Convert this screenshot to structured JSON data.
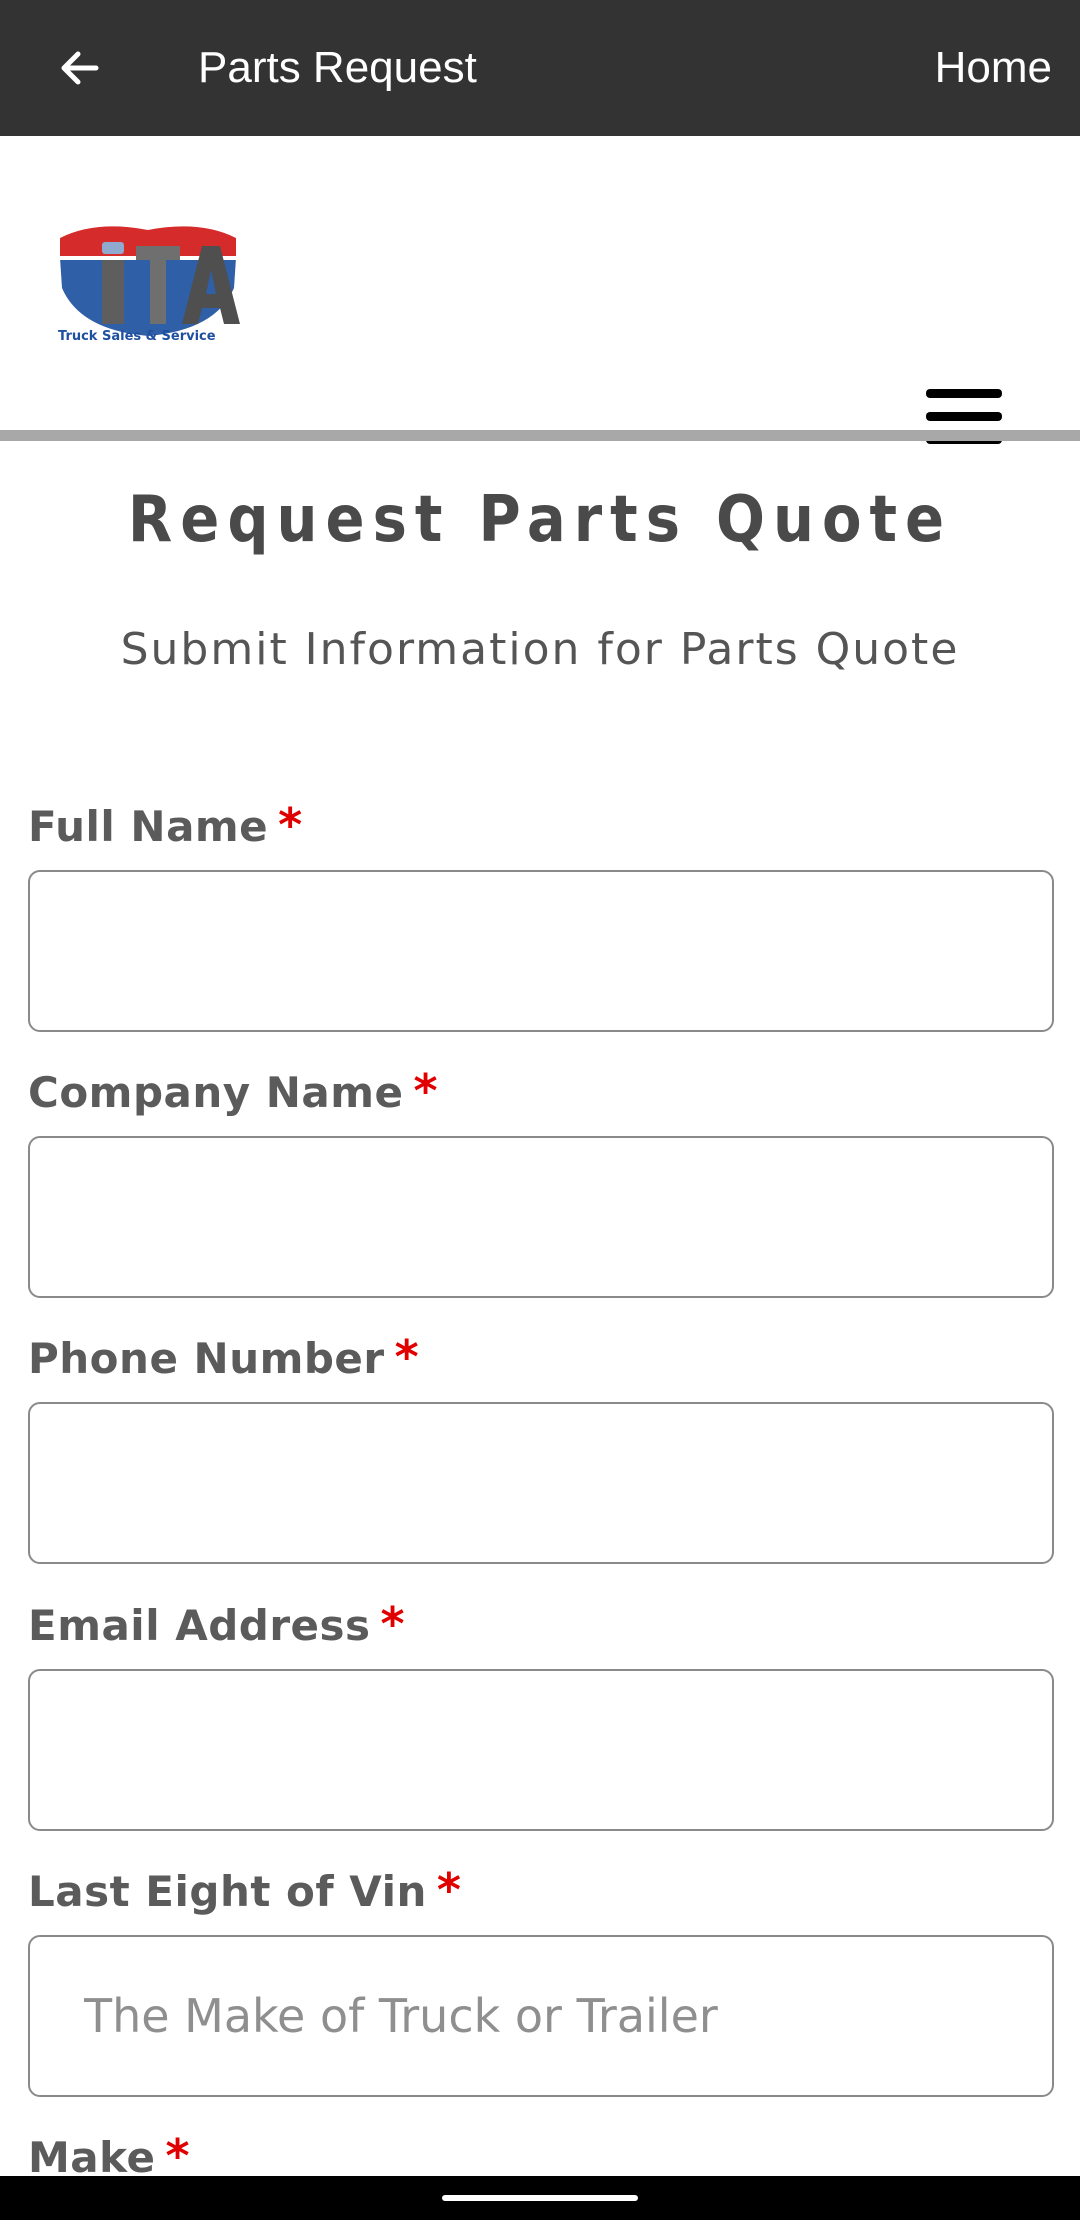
{
  "appbar": {
    "title": "Parts Request",
    "home_label": "Home"
  },
  "logo": {
    "brand_text": "iTA",
    "tagline": "Truck Sales & Service",
    "colors": {
      "red": "#d62b2b",
      "blue": "#2f5fa6",
      "gray": "#6d6d6d"
    }
  },
  "page": {
    "heading": "Request Parts Quote",
    "subheading": "Submit Information for Parts Quote"
  },
  "form": {
    "required_marker": "*",
    "fields": [
      {
        "label": "Full Name",
        "value": "",
        "placeholder": ""
      },
      {
        "label": "Company Name",
        "value": "",
        "placeholder": ""
      },
      {
        "label": "Phone Number",
        "value": "",
        "placeholder": ""
      },
      {
        "label": "Email Address",
        "value": "",
        "placeholder": ""
      },
      {
        "label": "Last Eight of Vin",
        "value": "",
        "placeholder": "The Make of Truck or Trailer"
      },
      {
        "label": "Make"
      }
    ]
  },
  "colors": {
    "appbar_bg": "#333333",
    "required": "#e10000",
    "divider": "#a8a8a8"
  },
  "icons": {
    "back": "arrow-left-icon",
    "menu": "hamburger-menu-icon"
  }
}
